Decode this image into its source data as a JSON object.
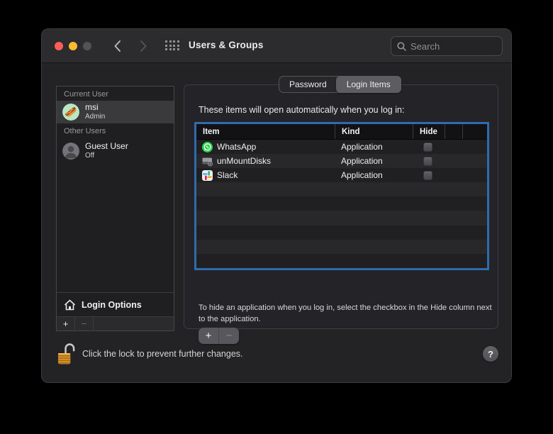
{
  "window": {
    "title": "Users & Groups",
    "search": {
      "placeholder": "Search"
    }
  },
  "sidebar": {
    "current_user_label": "Current User",
    "current_user": {
      "name": "msi",
      "role": "Admin"
    },
    "other_users_label": "Other Users",
    "guest_user": {
      "name": "Guest User",
      "status": "Off"
    },
    "login_options_label": "Login Options",
    "add_label": "+",
    "remove_label": "−"
  },
  "main": {
    "tabs": [
      {
        "label": "Password",
        "selected": false
      },
      {
        "label": "Login Items",
        "selected": true
      }
    ],
    "intro": "These items will open automatically when you log in:",
    "table": {
      "columns": [
        "Item",
        "Kind",
        "Hide"
      ],
      "rows": [
        {
          "name": "WhatsApp",
          "kind": "Application",
          "hide": false
        },
        {
          "name": "unMountDisks",
          "kind": "Application",
          "hide": false
        },
        {
          "name": "Slack",
          "kind": "Application",
          "hide": false
        }
      ]
    },
    "helper_text": "To hide an application when you log in, select the checkbox in the Hide column next to the application.",
    "add_label": "+",
    "remove_label": "−"
  },
  "footer": {
    "lock_text": "Click the lock to prevent further changes.",
    "help_label": "?"
  },
  "colors": {
    "focus_ring": "#2d6dae",
    "tab_selected": "#5d5d61",
    "traffic_red": "#ff5f57",
    "traffic_yellow": "#febc2e",
    "whatsapp_green": "#2bd24b",
    "avatar_mint": "#b9e8c2"
  }
}
